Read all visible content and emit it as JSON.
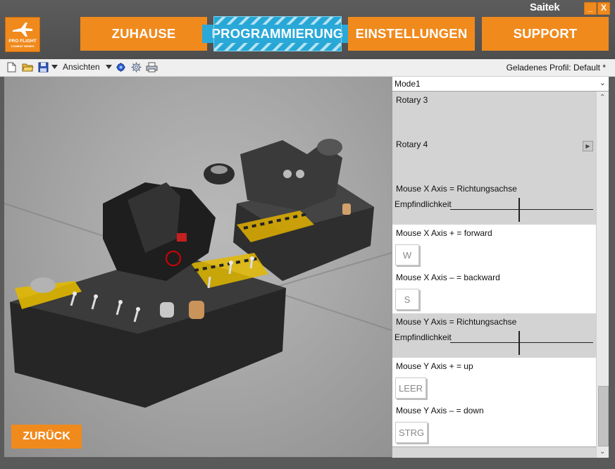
{
  "logo": {
    "line1": "PRO FLIGHT",
    "line2": "COMBAT SERIES"
  },
  "brand": "Saitek",
  "window_controls": {
    "minimize": "_",
    "close": "X"
  },
  "nav": [
    {
      "label": "ZUHAUSE",
      "active": false
    },
    {
      "label": "PROGRAMMIERUNG",
      "active": true
    },
    {
      "label": "EINSTELLUNGEN",
      "active": false
    },
    {
      "label": "SUPPORT",
      "active": false
    }
  ],
  "toolbar": {
    "icons": [
      "new-file-icon",
      "open-folder-icon",
      "save-icon",
      "dropdown-arrow-icon",
      "bug-icon",
      "gear-icon",
      "print-icon"
    ],
    "views_label": "Ansichten",
    "profile_label": "Geladenes Profil: Default *"
  },
  "back_label": "ZURÜCK",
  "mode": {
    "selected": "Mode1"
  },
  "panel": {
    "rotary3": {
      "label": "Rotary 3"
    },
    "rotary4": {
      "label": "Rotary 4"
    },
    "mouse_x_axis": {
      "label": "Mouse X Axis = Richtungsachse",
      "sensitivity": "Empfindlichkeit"
    },
    "mouse_x_plus": {
      "label": "Mouse X Axis  +  = forward",
      "key": "W"
    },
    "mouse_x_minus": {
      "label": "Mouse X Axis  –  = backward",
      "key": "S"
    },
    "mouse_y_axis": {
      "label": "Mouse Y Axis = Richtungsachse",
      "sensitivity": "Empfindlichkeit"
    },
    "mouse_y_plus": {
      "label": "Mouse Y Axis  +  = up",
      "key": "LEER"
    },
    "mouse_y_minus": {
      "label": "Mouse Y Axis  –  = down",
      "key": "STRG"
    }
  },
  "colors": {
    "accent": "#f08a1d",
    "active_tab": "#26a7d6",
    "frame": "#5b5b5b"
  }
}
